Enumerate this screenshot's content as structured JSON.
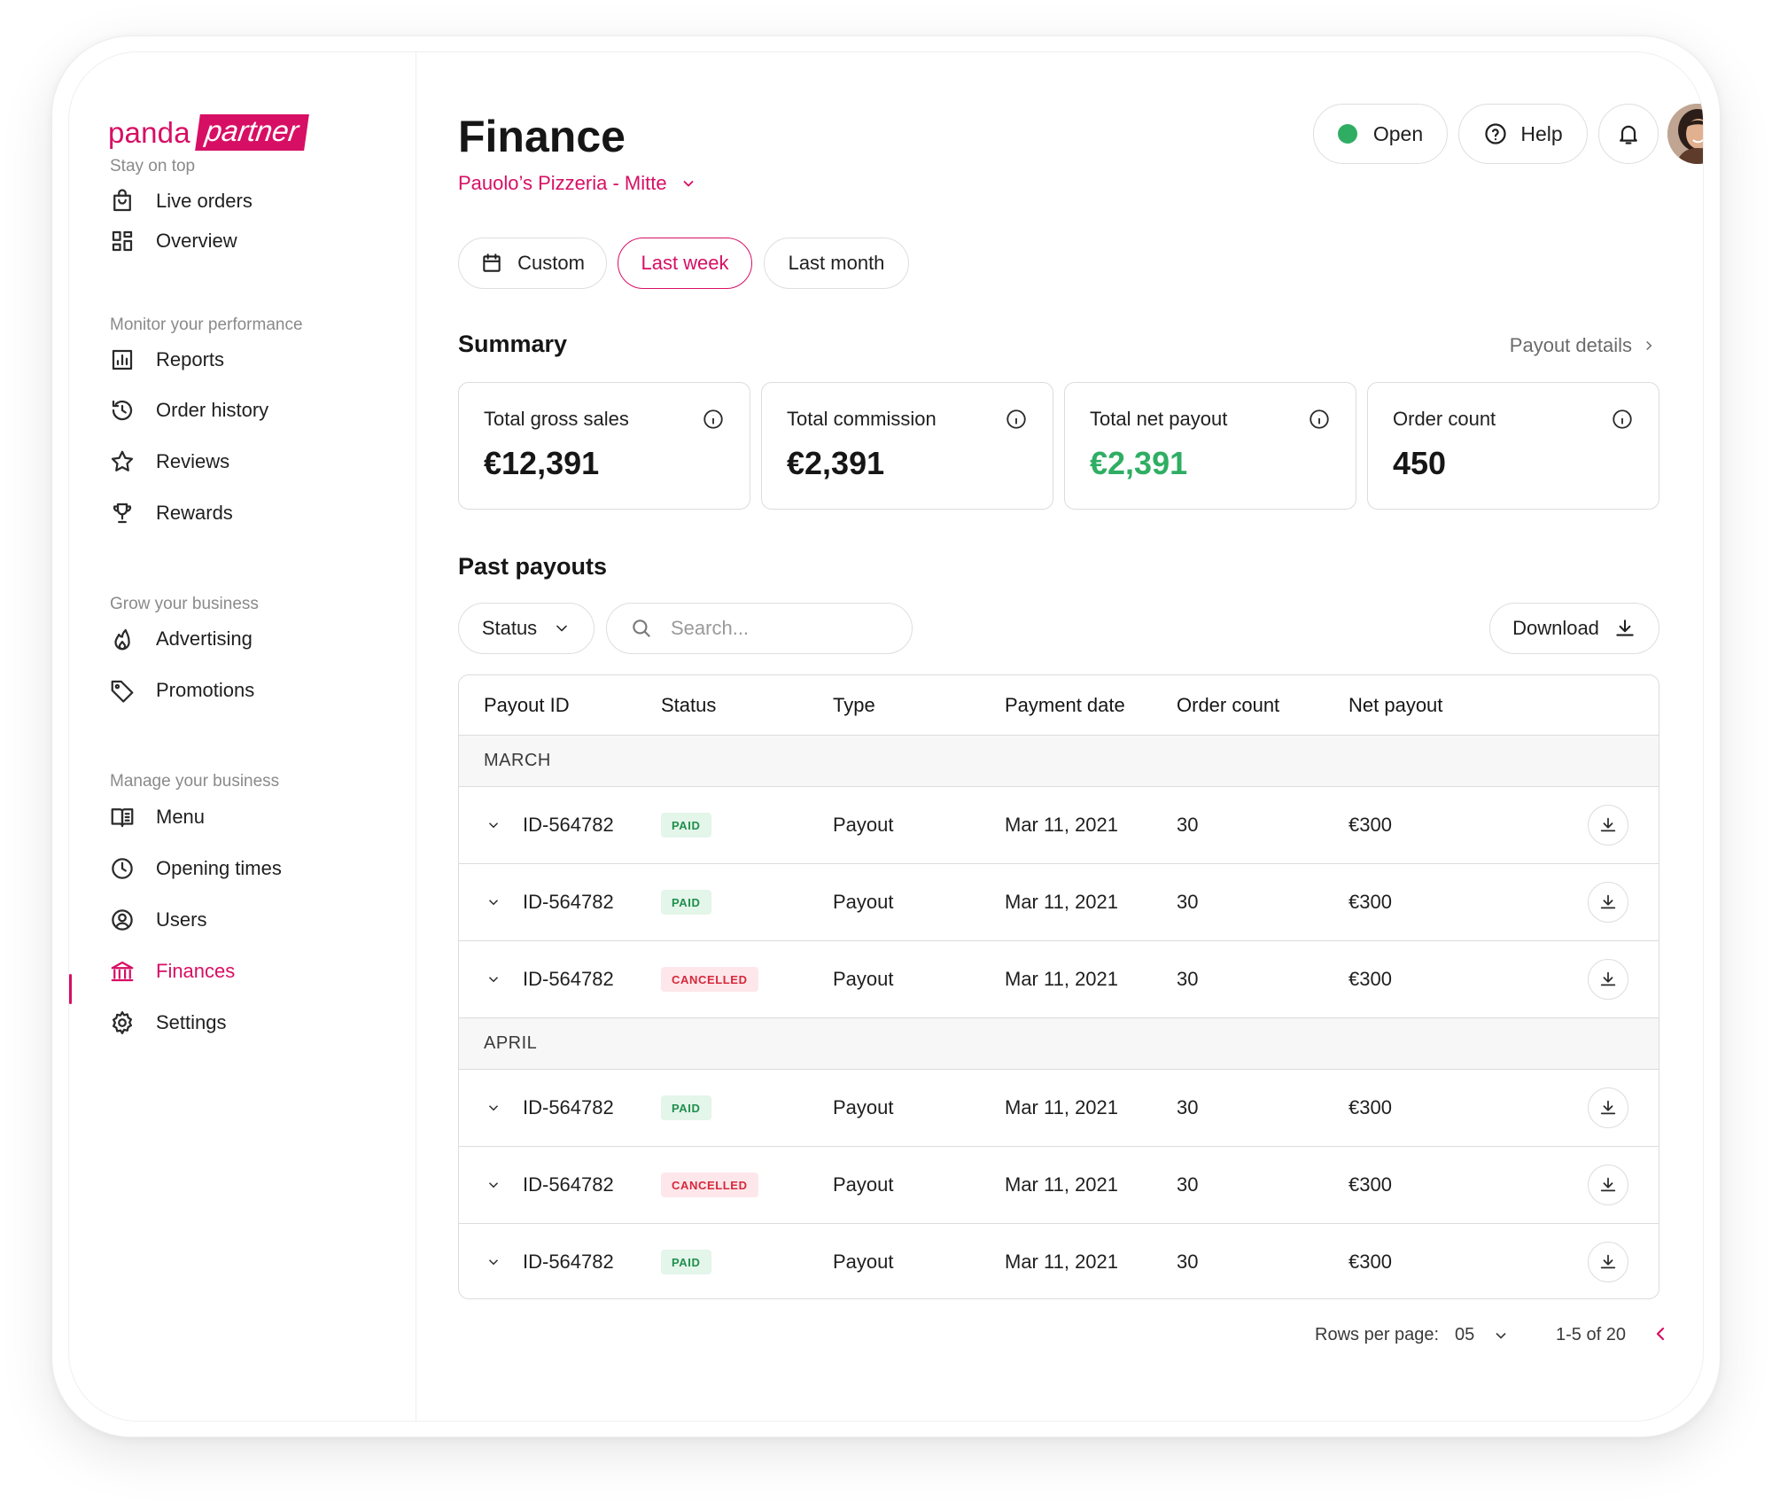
{
  "brand": {
    "part1": "panda",
    "part2": "partner"
  },
  "sidebar": {
    "sections": [
      {
        "label": "Stay on top",
        "items": [
          {
            "label": "Live orders",
            "icon": "shopping-bag-icon"
          },
          {
            "label": "Overview",
            "icon": "dashboard-icon"
          }
        ]
      },
      {
        "label": "Monitor your performance",
        "items": [
          {
            "label": "Reports",
            "icon": "bar-chart-icon"
          },
          {
            "label": "Order history",
            "icon": "history-icon"
          },
          {
            "label": "Reviews",
            "icon": "star-icon"
          },
          {
            "label": "Rewards",
            "icon": "trophy-icon"
          }
        ]
      },
      {
        "label": "Grow your business",
        "items": [
          {
            "label": "Advertising",
            "icon": "flame-icon"
          },
          {
            "label": "Promotions",
            "icon": "tag-icon"
          }
        ]
      },
      {
        "label": "Manage your business",
        "items": [
          {
            "label": "Menu",
            "icon": "book-icon"
          },
          {
            "label": "Opening times",
            "icon": "clock-icon"
          },
          {
            "label": "Users",
            "icon": "user-circle-icon"
          },
          {
            "label": "Finances",
            "icon": "bank-icon",
            "active": true
          },
          {
            "label": "Settings",
            "icon": "gear-icon"
          }
        ]
      }
    ]
  },
  "header": {
    "title": "Finance",
    "store": "Pauolo’s Pizzeria - Mitte",
    "status_label": "Open",
    "status_color": "#2fae63",
    "help_label": "Help"
  },
  "filters": {
    "custom": "Custom",
    "last_week": "Last week",
    "last_month": "Last month",
    "selected": "Last week"
  },
  "summary": {
    "title": "Summary",
    "details_link": "Payout details",
    "cards": [
      {
        "label": "Total gross sales",
        "value": "€12,391"
      },
      {
        "label": "Total commission",
        "value": "€2,391"
      },
      {
        "label": "Total net payout",
        "value": "€2,391"
      },
      {
        "label": "Order count",
        "value": "450"
      }
    ]
  },
  "payouts": {
    "title": "Past payouts",
    "status_filter": "Status",
    "search_placeholder": "Search...",
    "download_label": "Download",
    "columns": [
      "Payout ID",
      "Status",
      "Type",
      "Payment date",
      "Order count",
      "Net payout"
    ],
    "groups": [
      {
        "label": "MARCH",
        "rows": [
          {
            "id": "ID-564782",
            "status": "PAID",
            "type": "Payout",
            "date": "Mar 11, 2021",
            "count": "30",
            "net": "€300"
          },
          {
            "id": "ID-564782",
            "status": "PAID",
            "type": "Payout",
            "date": "Mar 11, 2021",
            "count": "30",
            "net": "€300"
          },
          {
            "id": "ID-564782",
            "status": "CANCELLED",
            "type": "Payout",
            "date": "Mar 11, 2021",
            "count": "30",
            "net": "€300"
          }
        ]
      },
      {
        "label": "APRIL",
        "rows": [
          {
            "id": "ID-564782",
            "status": "PAID",
            "type": "Payout",
            "date": "Mar 11, 2021",
            "count": "30",
            "net": "€300"
          },
          {
            "id": "ID-564782",
            "status": "CANCELLED",
            "type": "Payout",
            "date": "Mar 11, 2021",
            "count": "30",
            "net": "€300"
          },
          {
            "id": "ID-564782",
            "status": "PAID",
            "type": "Payout",
            "date": "Mar 11, 2021",
            "count": "30",
            "net": "€300"
          }
        ]
      }
    ]
  },
  "pagination": {
    "rows_label": "Rows per page:",
    "rows_value": "05",
    "range": "1-5 of 20"
  },
  "colors": {
    "brand": "#d70f64",
    "success": "#2fae63",
    "danger": "#d6283b"
  }
}
